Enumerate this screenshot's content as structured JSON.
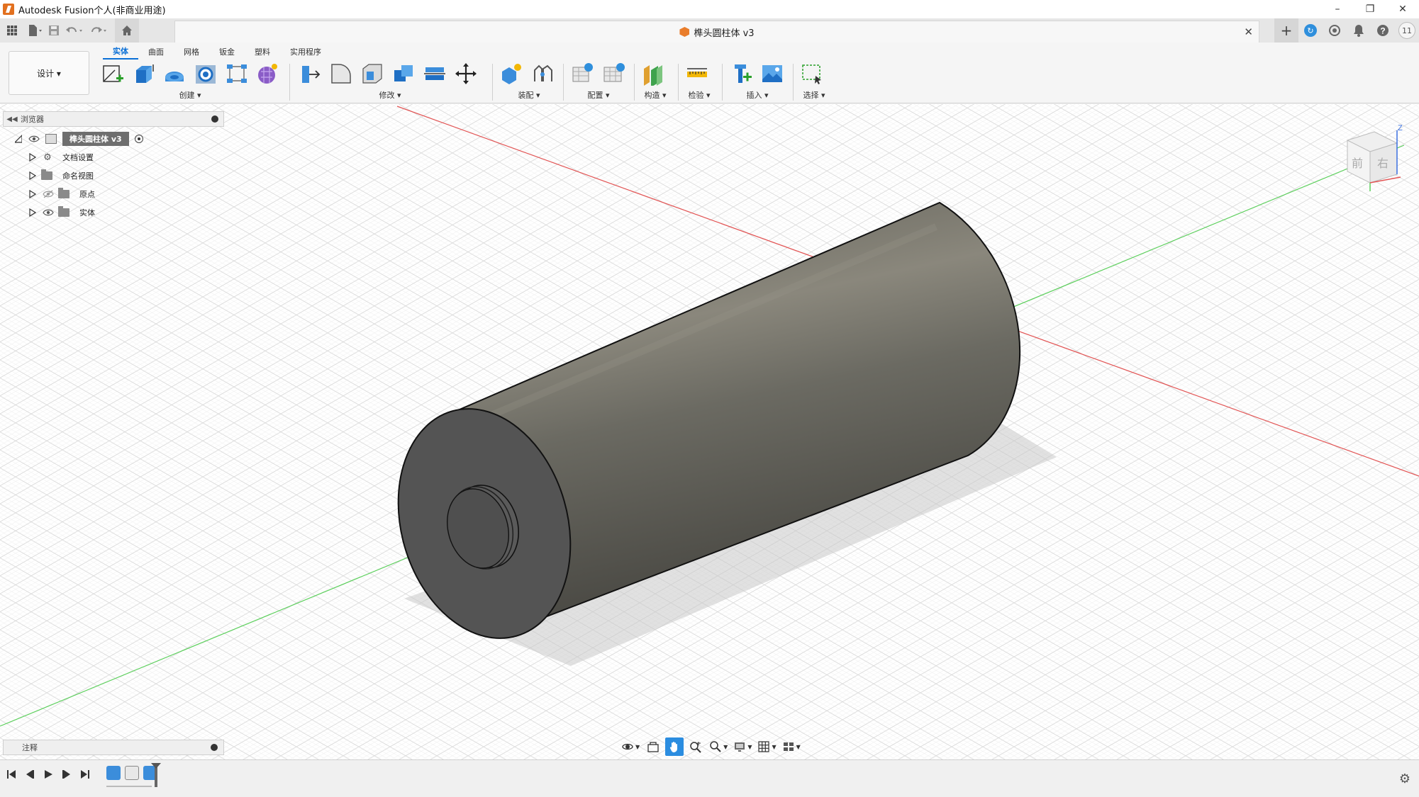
{
  "window": {
    "title": "Autodesk Fusion个人(非商业用途)",
    "controls": {
      "minimize": "–",
      "restore": "❐",
      "close": "✕"
    }
  },
  "appbar": {
    "document_tab_title": "榫头圆柱体 v3",
    "document_tab_close": "✕",
    "user_initials": "11",
    "icons": [
      "grid-icon",
      "file-icon",
      "save-icon",
      "undo-icon",
      "redo-icon",
      "home-icon",
      "add-tab-icon",
      "extension-icon",
      "job-status-icon",
      "notifications-icon",
      "help-icon"
    ]
  },
  "ribbon": {
    "workspace_label": "设计 ▾",
    "tabs": [
      {
        "label": "实体",
        "active": true
      },
      {
        "label": "曲面",
        "active": false
      },
      {
        "label": "网格",
        "active": false
      },
      {
        "label": "钣金",
        "active": false
      },
      {
        "label": "塑料",
        "active": false
      },
      {
        "label": "实用程序",
        "active": false
      }
    ],
    "groups": {
      "create": "创建 ▾",
      "modify": "修改 ▾",
      "assemble": "装配 ▾",
      "configure": "配置 ▾",
      "construct": "构造 ▾",
      "inspect": "检验 ▾",
      "insert": "插入 ▾",
      "select": "选择 ▾"
    },
    "accent_color": "#0a6fd6"
  },
  "browser": {
    "title": "浏览器",
    "root_label": "榫头圆柱体 v3",
    "items": [
      {
        "label": "文档设置",
        "icon": "gear-icon"
      },
      {
        "label": "命名视图",
        "icon": "folder-icon"
      },
      {
        "label": "原点",
        "icon": "folder-icon"
      },
      {
        "label": "实体",
        "icon": "folder-icon"
      }
    ]
  },
  "comments": {
    "title": "注释"
  },
  "viewcube": {
    "axis_z": "Z",
    "face_front": "前",
    "face_right": "右"
  },
  "navbar": {
    "icons": [
      "orbit-icon",
      "look-at-icon",
      "pan-icon",
      "zoom-icon",
      "fit-icon",
      "display-settings-icon",
      "grid-settings-icon",
      "viewports-icon"
    ],
    "active": "pan-icon"
  },
  "timeline": {
    "icons": [
      "go-to-start-icon",
      "step-back-icon",
      "play-icon",
      "step-forward-icon",
      "go-to-end-icon",
      "settings-icon"
    ]
  },
  "colors": {
    "x_axis": "#e25454",
    "y_axis": "#5ccf5c",
    "z_axis": "#3a6fe0",
    "body_dark": "#545454",
    "body_mid": "#7c7a72",
    "active_nav": "#2b8de0"
  }
}
